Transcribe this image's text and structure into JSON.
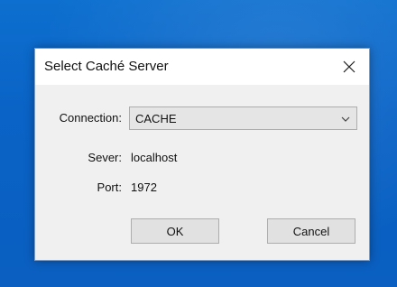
{
  "dialog": {
    "title": "Select Caché Server",
    "close_icon": "close-icon"
  },
  "form": {
    "connection_label": "Connection:",
    "connection_value": "CACHE",
    "server_label": "Sever:",
    "server_value": "localhost",
    "port_label": "Port:",
    "port_value": "1972"
  },
  "buttons": {
    "ok_label": "OK",
    "cancel_label": "Cancel"
  },
  "colors": {
    "desktop": "#0a63c6",
    "dialog_bg": "#f0f0f0",
    "titlebar_bg": "#ffffff"
  }
}
